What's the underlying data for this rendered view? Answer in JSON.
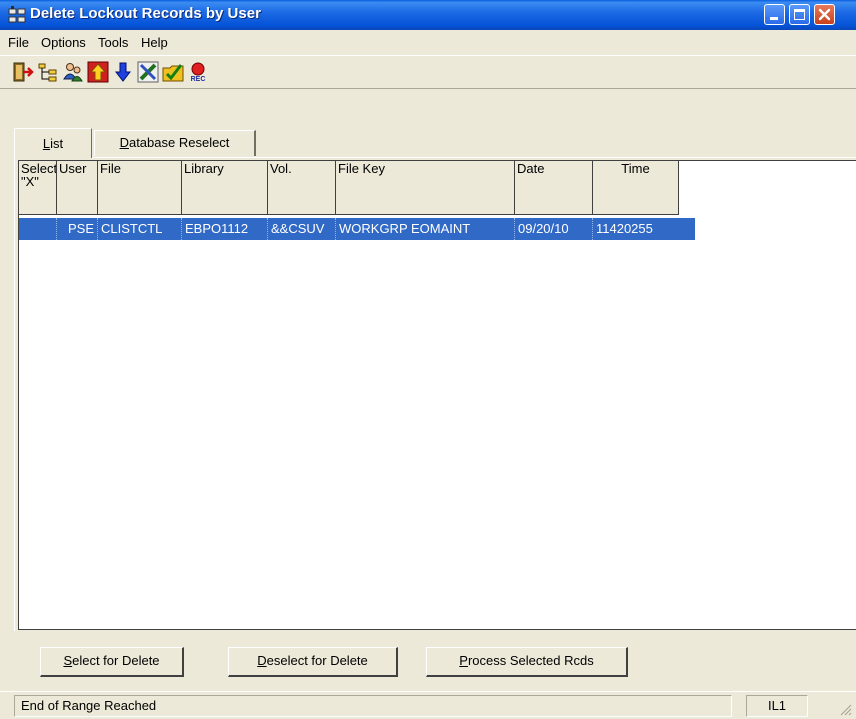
{
  "window": {
    "title": "Delete Lockout Records by User"
  },
  "menu": [
    "File",
    "Options",
    "Tools",
    "Help"
  ],
  "toolbar": {
    "icons": [
      "exit-icon",
      "tree-icon",
      "users-icon",
      "up-arrow-icon",
      "down-arrow-icon",
      "tools-icon",
      "folder-check-icon",
      "record-icon"
    ],
    "rec_label": "REC"
  },
  "tabs": [
    {
      "label": "List",
      "underline": "L",
      "rest": "ist"
    },
    {
      "label": "Database Reselect",
      "underline": "D",
      "rest": "atabase Reselect"
    }
  ],
  "grid": {
    "headers": [
      {
        "line1": "Select",
        "line2": "\"X\""
      },
      {
        "line1": "User",
        "line2": ""
      },
      {
        "line1": "File",
        "line2": ""
      },
      {
        "line1": "Library",
        "line2": ""
      },
      {
        "line1": "Vol.",
        "line2": ""
      },
      {
        "line1": "File Key",
        "line2": ""
      },
      {
        "line1": "Date",
        "line2": ""
      },
      {
        "line1": "Time",
        "line2": ""
      }
    ],
    "rows": [
      [
        "",
        "PSE",
        "CLISTCTL",
        "EBPO1112",
        "&&CSUV",
        "WORKGRP EOMAINT",
        "09/20/10",
        "11420255"
      ]
    ]
  },
  "buttons": [
    {
      "label": "Select for Delete",
      "underline": "S",
      "rest": "elect for Delete"
    },
    {
      "label": "Deselect for Delete",
      "underline": "D",
      "rest": "eselect for Delete"
    },
    {
      "label": "Process Selected Rcds",
      "underline": "P",
      "rest": "rocess Selected Rcds"
    }
  ],
  "status": {
    "message": "End of Range Reached",
    "code": "IL1"
  }
}
